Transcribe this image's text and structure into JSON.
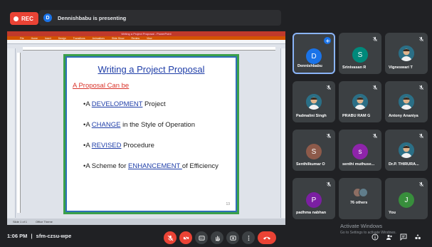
{
  "topbar": {
    "rec_label": "REC",
    "presenter_initial": "D",
    "presenting_text": "Dennishbabu is presenting"
  },
  "slide": {
    "window_title": "Writing a Project Proposal - PowerPoint",
    "menu": [
      "File",
      "Home",
      "Insert",
      "Design",
      "Transitions",
      "Animations",
      "Slide Show",
      "Review",
      "View"
    ],
    "status_left": "Slide 1 of 1",
    "status_right": "Office Theme",
    "title": "Writing a Project Proposal",
    "subheading": "A Proposal Can be",
    "bullets": [
      {
        "pre": "•A ",
        "kw": "DEVELOPMENT",
        "post": " Project"
      },
      {
        "pre": "•A ",
        "kw": "CHANGE",
        "post": " in the Style of Operation"
      },
      {
        "pre": "•A ",
        "kw": "REVISED",
        "post": " Procedure"
      },
      {
        "pre": "•A Scheme for ",
        "kw": "ENHANCEMENT ",
        "post": "of Efficiency"
      }
    ],
    "page_number": "13"
  },
  "participants": [
    {
      "name": "Dennishbabu",
      "initial": "D",
      "color": "#1a73e8",
      "type": "letter",
      "speaking": true
    },
    {
      "name": "Srinivasan R",
      "initial": "S",
      "color": "#00897b",
      "type": "letter"
    },
    {
      "name": "Vigneswari T",
      "initial": "",
      "color": "#2b6f86",
      "type": "photo"
    },
    {
      "name": "Padmalini Singh",
      "initial": "",
      "color": "#2b6f86",
      "type": "photo"
    },
    {
      "name": "PRABU RAM G",
      "initial": "",
      "color": "#2b6f86",
      "type": "photo"
    },
    {
      "name": "Antony Ananiya",
      "initial": "",
      "color": "#2b6f86",
      "type": "photo"
    },
    {
      "name": "Senthilkumar O",
      "initial": "S",
      "color": "#8d5a4a",
      "type": "letter"
    },
    {
      "name": "senthi muthuse...",
      "initial": "s",
      "color": "#8e24aa",
      "type": "letter"
    },
    {
      "name": "Dr.P. THIRURA...",
      "initial": "",
      "color": "#2b6f86",
      "type": "photo"
    },
    {
      "name": "padhma nabhan",
      "initial": "P",
      "color": "#7b1fa2",
      "type": "letter"
    },
    {
      "name": "76 others",
      "initial": "",
      "color": "#5f6368",
      "type": "others"
    },
    {
      "name": "You",
      "initial": "J",
      "color": "#388e3c",
      "type": "letter"
    }
  ],
  "bottombar": {
    "time": "1:06 PM",
    "separator": "|",
    "meeting_code": "sfm-czsu-wpe"
  },
  "watermark": {
    "line1": "Activate Windows",
    "line2": "Go to Settings to activate Windows."
  },
  "colors": {
    "danger": "#ea4335",
    "accent": "#1a73e8",
    "tile_bg": "#3c4043"
  }
}
